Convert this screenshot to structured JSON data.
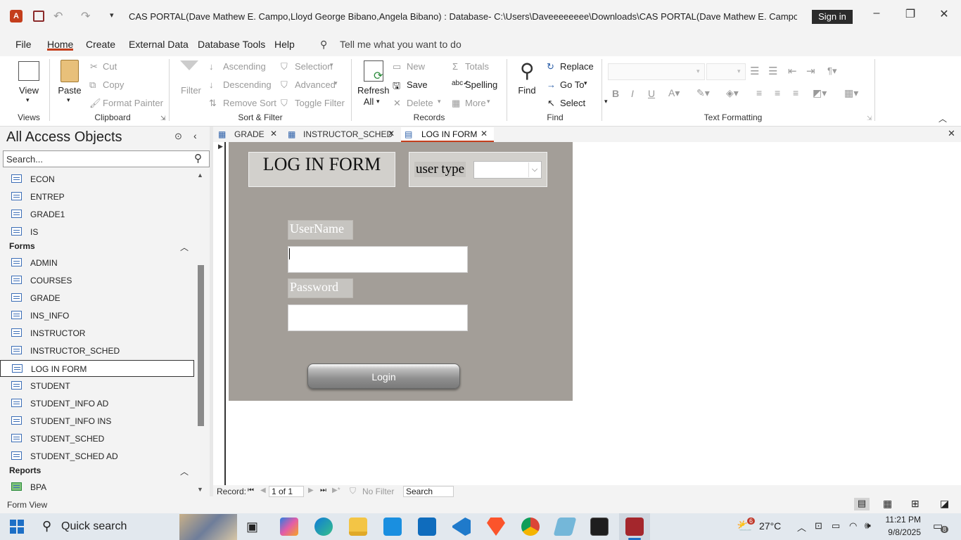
{
  "titlebar": {
    "title": "CAS PORTAL(Dave Mathew E. Campo,Lloyd George Bibano,Angela Bibano) : Database- C:\\Users\\Daveeeeeeee\\Downloads\\CAS PORTAL(Dave Mathew E. Campo,Lloyd George Bib...",
    "signin": "Sign in"
  },
  "menu": {
    "items": [
      "File",
      "Home",
      "Create",
      "External Data",
      "Database Tools",
      "Help"
    ],
    "tell_me": "Tell me what you want to do"
  },
  "ribbon": {
    "views": {
      "view": "View",
      "label": "Views"
    },
    "clipboard": {
      "paste": "Paste",
      "cut": "Cut",
      "copy": "Copy",
      "format_painter": "Format Painter",
      "label": "Clipboard"
    },
    "sort_filter": {
      "filter": "Filter",
      "ascending": "Ascending",
      "descending": "Descending",
      "remove_sort": "Remove Sort",
      "selection": "Selection",
      "advanced": "Advanced",
      "toggle_filter": "Toggle Filter",
      "label": "Sort & Filter"
    },
    "records": {
      "refresh": "Refresh",
      "refresh_all": "All",
      "new": "New",
      "save": "Save",
      "delete": "Delete",
      "totals": "Totals",
      "spelling": "Spelling",
      "more": "More",
      "label": "Records"
    },
    "find": {
      "find": "Find",
      "replace": "Replace",
      "goto": "Go To",
      "select": "Select",
      "label": "Find"
    },
    "text_formatting": {
      "label": "Text Formatting",
      "bold": "B",
      "italic": "I",
      "underline": "U"
    }
  },
  "nav": {
    "title": "All Access Objects",
    "search_placeholder": "Search...",
    "tables": [
      "ECON",
      "ENTREP",
      "GRADE1",
      "IS"
    ],
    "forms_header": "Forms",
    "forms": [
      "ADMIN",
      "COURSES",
      "GRADE",
      "INS_INFO",
      "INSTRUCTOR",
      "INSTRUCTOR_SCHED",
      "LOG IN FORM",
      "STUDENT",
      "STUDENT_INFO AD",
      "STUDENT_INFO INS",
      "STUDENT_SCHED",
      "STUDENT_SCHED AD"
    ],
    "selected": "LOG IN FORM",
    "reports_header": "Reports",
    "reports": [
      "BPA"
    ]
  },
  "tabs": [
    "GRADE",
    "INSTRUCTOR_SCHED",
    "LOG IN FORM"
  ],
  "form": {
    "title": "LOG IN FORM",
    "user_type_label": "user type",
    "user_type_value": "",
    "username_label": "UserName",
    "username_value": "",
    "password_label": "Password",
    "password_value": "",
    "login_button": "Login"
  },
  "record_nav": {
    "record_label": "Record:",
    "position": "1 of 1",
    "filter": "No Filter",
    "search": "Search"
  },
  "status": {
    "view": "Form View"
  },
  "taskbar": {
    "search": "Quick search",
    "weather": "27°C",
    "weather_badge": "6",
    "time": "11:21 PM",
    "date": "9/8/2025",
    "notifications": "8"
  }
}
